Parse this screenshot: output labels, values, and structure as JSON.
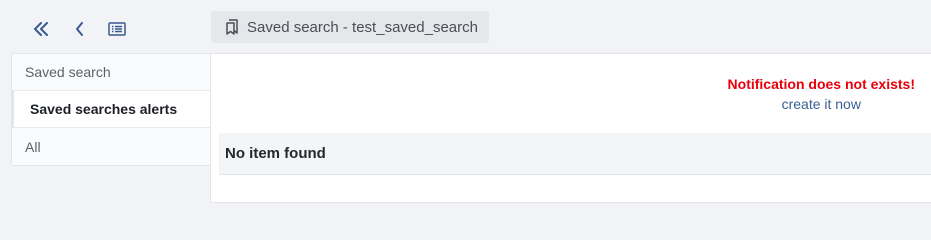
{
  "toolbar": {
    "collapse_icon": "double-chevron-left-icon",
    "back_icon": "chevron-left-icon",
    "list_icon": "list-view-icon"
  },
  "breadcrumb": {
    "icon": "bookmarks-icon",
    "label": "Saved search - test_saved_search"
  },
  "sidebar": {
    "items": [
      {
        "label": "Saved search",
        "active": false
      },
      {
        "label": "Saved searches alerts",
        "active": true
      },
      {
        "label": "All",
        "active": false
      }
    ]
  },
  "main": {
    "notification_error": "Notification does not exists!",
    "create_link": "create it now",
    "empty_message": "No item found"
  },
  "colors": {
    "error": "#e8000b",
    "link": "#3a5f95",
    "icon": "#3b5a8f"
  }
}
